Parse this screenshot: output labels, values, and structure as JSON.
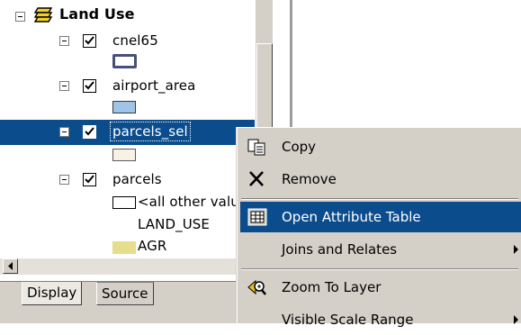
{
  "toc": {
    "group_label": "Land Use",
    "layers": [
      {
        "name": "cnel65",
        "checked": true
      },
      {
        "name": "airport_area",
        "checked": true
      },
      {
        "name": "parcels_sel",
        "checked": true,
        "selected": true
      },
      {
        "name": "parcels",
        "checked": true
      }
    ],
    "parcels_legend": {
      "other_values": "<all other values>",
      "field": "LAND_USE",
      "class1": "AGR"
    }
  },
  "tabs": [
    "Display",
    "Source"
  ],
  "context_menu": {
    "items": [
      {
        "label": "Copy",
        "icon": "copy-icon"
      },
      {
        "label": "Remove",
        "icon": "remove-icon"
      },
      {
        "label": "Open Attribute Table",
        "icon": "table-icon",
        "highlighted": true
      },
      {
        "label": "Joins and Relates",
        "submenu": true
      },
      {
        "label": "Zoom To Layer",
        "icon": "zoom-to-layer-icon"
      },
      {
        "label": "Visible Scale Range",
        "submenu": true
      }
    ]
  },
  "colors": {
    "selection": "#0b4c8c",
    "airport_fill": "#9fc4e8",
    "cnel_outline": "#47507a",
    "parcels_sel_fill": "#f7f2e4",
    "agr_fill": "#e6de8c"
  }
}
